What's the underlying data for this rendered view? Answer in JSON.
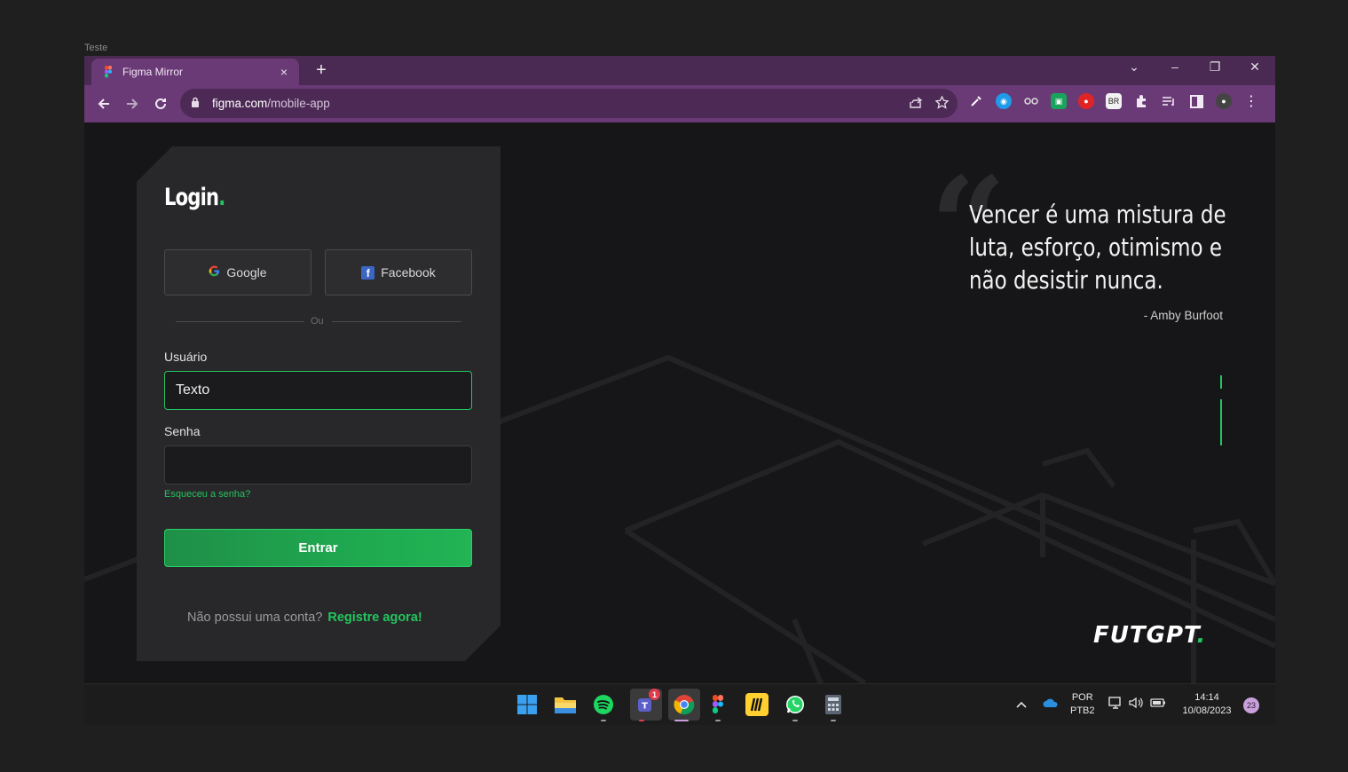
{
  "frame": {
    "label": "Teste"
  },
  "browser": {
    "tab_title": "Figma Mirror",
    "close_symbol": "×",
    "new_tab_symbol": "+",
    "url_host": "figma.com",
    "url_path": "/mobile-app",
    "window_controls": [
      "⌄",
      "–",
      "❐",
      "✕"
    ]
  },
  "login": {
    "title": "Login",
    "title_dot": ".",
    "google_label": "Google",
    "facebook_label": "Facebook",
    "divider_text": "Ou",
    "user_label": "Usuário",
    "user_value": "Texto",
    "password_label": "Senha",
    "password_value": "",
    "forgot_label": "Esqueceu a senha?",
    "submit_label": "Entrar",
    "signup_prompt": "Não possui uma conta?",
    "signup_link": "Registre agora!"
  },
  "quote": {
    "mark": "“",
    "lines": [
      "Vencer é uma mistura de",
      "luta, esforço, otimismo e",
      "não desistir nunca."
    ],
    "author": "- Amby Burfoot"
  },
  "brand": {
    "name": "FUTGPT",
    "dot": "."
  },
  "taskbar": {
    "teams_badge": "1",
    "lang_line1": "POR",
    "lang_line2": "PTB2",
    "time": "14:14",
    "date": "10/08/2023",
    "notification_count": "23"
  },
  "colors": {
    "accent": "#22c55e",
    "tab_bar": "#4a2a52",
    "toolbar": "#6a3a76"
  }
}
